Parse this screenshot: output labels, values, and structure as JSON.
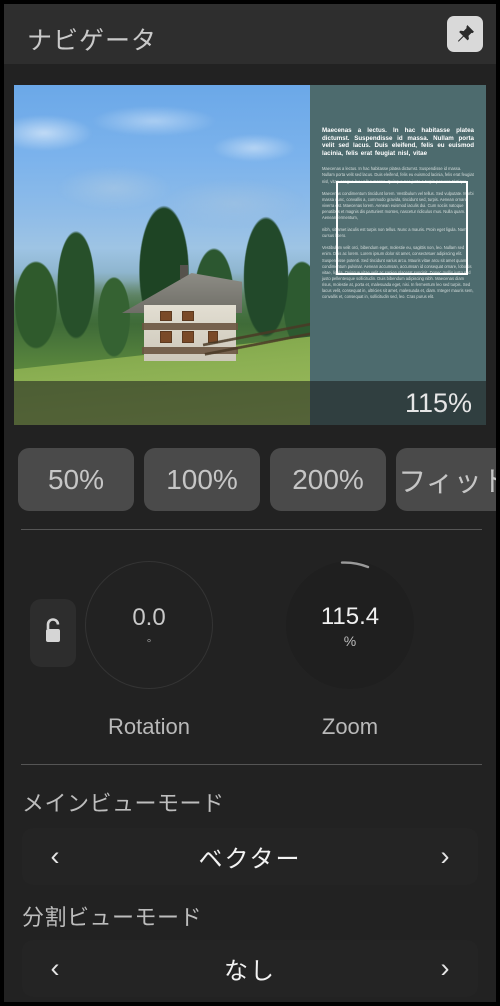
{
  "header": {
    "title": "ナビゲータ",
    "pin_icon": "pin-icon"
  },
  "preview": {
    "zoom_overlay": "115%",
    "document": {
      "heading": "Maecenas a lectus. In hac habitasse platea dictumst. Suspendisse id massa. Nullam porta velit sed lacus. Duis eleifend, felis eu euismod lacinia, felis erat feugiat nisl, vitae",
      "paragraph_1": "Maecenas a lectus. In hac habitasse platea dictumst. Suspendisse id massa. Nullam porta velit sed lacus. Duis eleifend, felis eu euismod lacinia, felis erat feugiat nisl, vitae congue leo velit a massa. Quisque nec justo a turpis posuere tristique.",
      "paragraph_2": "Maecenas condimentum tincidunt lorem. Vestibulum vel tellus. Sed vulputate. Morbi massa nunc, convallis a, commodo gravida, tincidunt sed, turpis. Aenean ornare viverra est. Maecenas lorem. Aenean euismod iaculis dui. Cum sociis natoque penatibus et magnis dis parturient montes, nascetur ridiculus mus. Nulla quam. Aenean fermentum,",
      "paragraph_3": "nibh, sit amet iaculis est turpis non tellus. Nunc a mauris. Proin eget ligula. Nam cursus libero.",
      "paragraph_4": "Vestibulum velit orci, bibendum eget, molestie eu, sagittis non, leo. Nullam sed enim. Duis ac lorem. Lorem ipsum dolor sit amet, consectetuer adipiscing elit. Suspendisse potenti. Sed tincidunt varius arcu. Mauris vitae arcu sit amet quam condimentum pulvinar. Aenean accumsan, accumsan id consequat ornare, lobortis vitae, ligula. Quisque vitae velit ac sapien placerat suscipit. Donec mollis justo sed justo pellentesque sollicitudin. Duis bibendum adipiscing nibh. Maecenas diam risus, molestie at, porta et, malesuada eget, nisi. In fermentum leo sed turpis. Sed lacus velit, consequat in, ultricies sit amet, malesuada et, diam. Integer mauris sem, convallis et, consequat in, sollicitudin sed, leo. Cras purus elit."
    }
  },
  "presets": {
    "buttons": [
      {
        "label": "50%"
      },
      {
        "label": "100%"
      },
      {
        "label": "200%"
      },
      {
        "label": "フィット"
      }
    ]
  },
  "knobs": {
    "lock_icon": "unlock-icon",
    "rotation": {
      "value": "0.0",
      "unit": "°",
      "label": "Rotation"
    },
    "zoom": {
      "value": "115.4",
      "unit": "%",
      "label": "Zoom"
    }
  },
  "main_view_mode": {
    "label": "メインビューモード",
    "value": "ベクター",
    "prev_icon": "chevron-left-icon",
    "next_icon": "chevron-right-icon"
  },
  "split_view_mode": {
    "label": "分割ビューモード",
    "value": "なし",
    "prev_icon": "chevron-left-icon",
    "next_icon": "chevron-right-icon"
  },
  "colors": {
    "panel_bg": "#222222",
    "header_bg": "#2e2e2e",
    "button_bg": "#4a4a4a",
    "stepper_bg": "#242424",
    "doc_teal": "#4d6b6e",
    "accent_text": "#f2f2f2"
  }
}
